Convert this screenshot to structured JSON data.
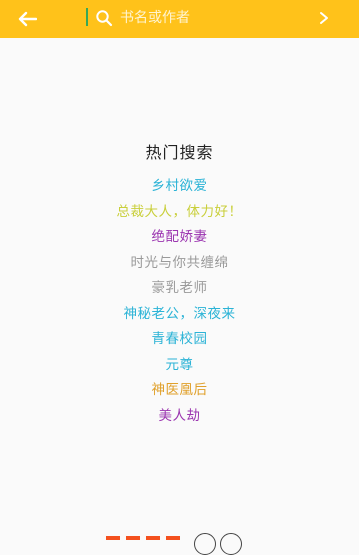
{
  "search": {
    "placeholder": "书名或作者",
    "value": ""
  },
  "hot": {
    "title": "热门搜索",
    "items": [
      {
        "label": "乡村欲爱",
        "color": "#2bb3d6"
      },
      {
        "label": "总裁大人，体力好！",
        "color": "#c9cf3a"
      },
      {
        "label": "绝配娇妻",
        "color": "#9b35b0"
      },
      {
        "label": "时光与你共缠绵",
        "color": "#9a9a9a"
      },
      {
        "label": "豪乳老师",
        "color": "#9a9a9a"
      },
      {
        "label": "神秘老公，深夜来",
        "color": "#2bb3d6"
      },
      {
        "label": "青春校园",
        "color": "#2bb3d6"
      },
      {
        "label": "元尊",
        "color": "#2bb3d6"
      },
      {
        "label": "神医凰后",
        "color": "#e0a02a"
      },
      {
        "label": "美人劫",
        "color": "#9b35b0"
      }
    ]
  },
  "colors": {
    "topbar": "#ffc21a",
    "cursor": "#3aa757"
  }
}
